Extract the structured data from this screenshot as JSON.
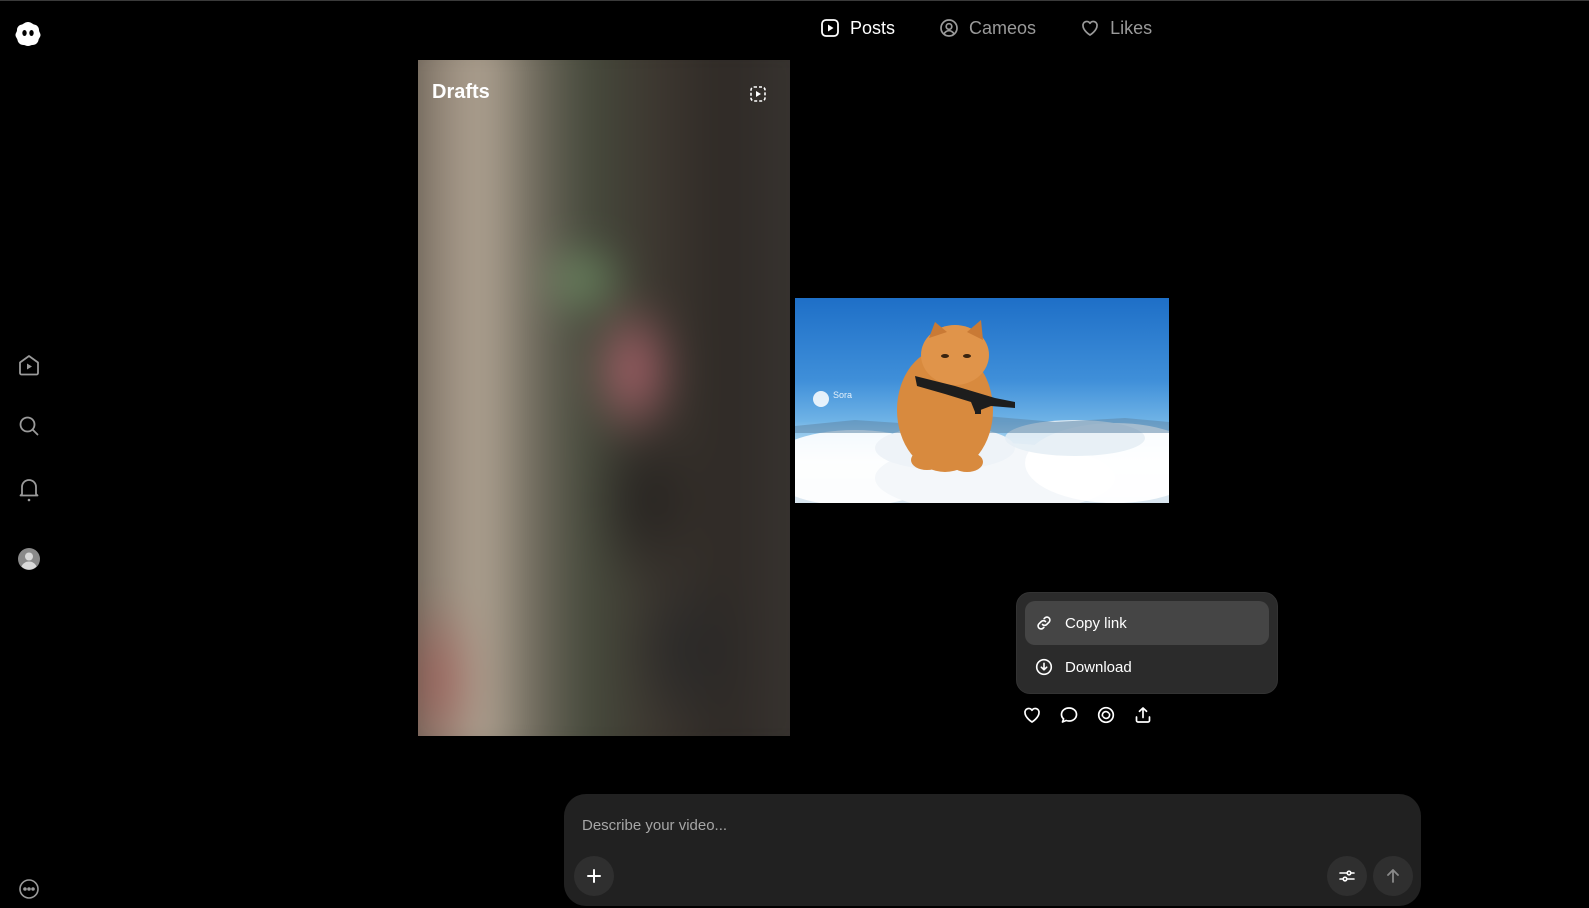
{
  "tabs": [
    {
      "label": "Posts",
      "icon": "play-square-icon",
      "active": true
    },
    {
      "label": "Cameos",
      "icon": "user-circle-icon",
      "active": false
    },
    {
      "label": "Likes",
      "icon": "heart-icon",
      "active": false
    }
  ],
  "sidebar": {
    "items": [
      {
        "icon": "home-play-icon"
      },
      {
        "icon": "search-icon"
      },
      {
        "icon": "bell-icon"
      },
      {
        "icon": "profile-avatar-icon"
      },
      {
        "icon": "more-icon"
      }
    ]
  },
  "drafts": {
    "title": "Drafts"
  },
  "preview": {
    "watermark": "Sora"
  },
  "menu": {
    "items": [
      {
        "label": "Copy link",
        "icon": "link-icon"
      },
      {
        "label": "Download",
        "icon": "download-icon"
      }
    ]
  },
  "actions": [
    "heart-icon",
    "comment-icon",
    "remix-icon",
    "share-icon"
  ],
  "composer": {
    "placeholder": "Describe your video..."
  },
  "colors": {
    "background": "#000000",
    "composer": "#212121",
    "menu": "#2b2b2b",
    "menu_hover": "#454545"
  }
}
